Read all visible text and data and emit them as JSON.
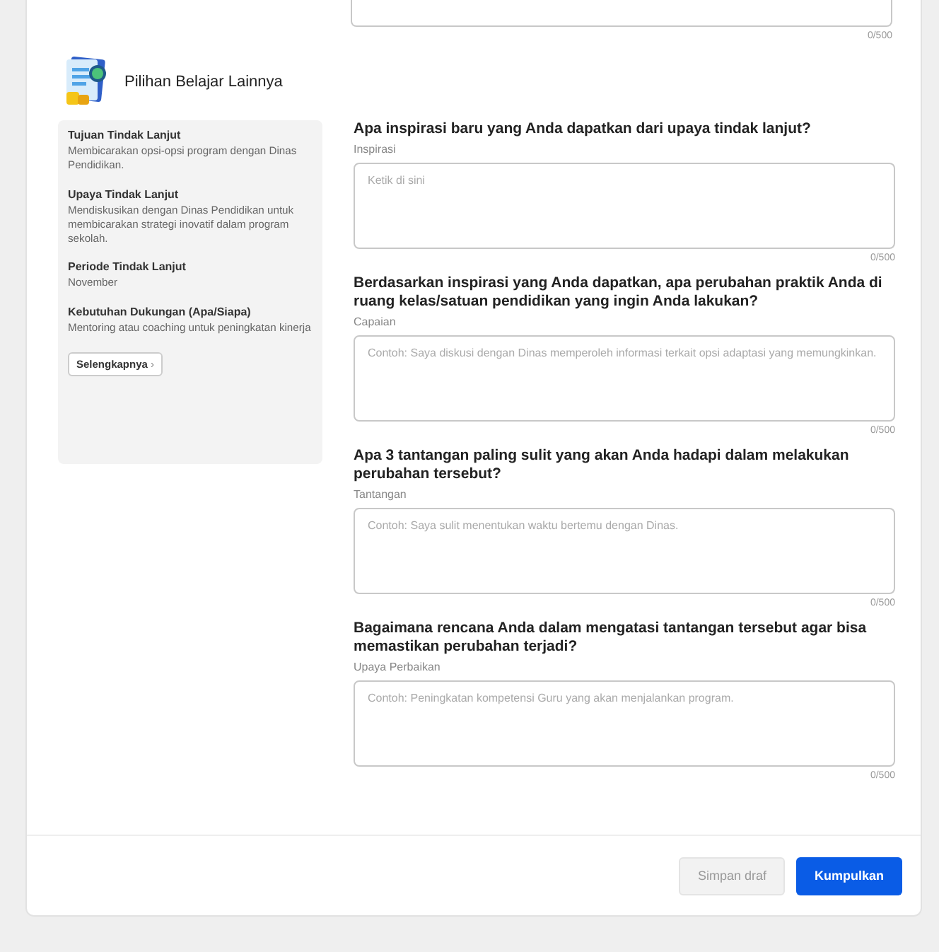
{
  "top_field": {
    "counter": "0/500"
  },
  "section": {
    "title": "Pilihan Belajar Lainnya"
  },
  "sidebar": {
    "items": [
      {
        "label": "Tujuan Tindak Lanjut",
        "value": "Membicarakan opsi-opsi program dengan Dinas Pendidikan."
      },
      {
        "label": "Upaya Tindak Lanjut",
        "value": "Mendiskusikan dengan Dinas Pendidikan untuk membicarakan strategi inovatif dalam program sekolah."
      },
      {
        "label": "Periode Tindak Lanjut",
        "value": "November"
      },
      {
        "label": "Kebutuhan Dukungan (Apa/Siapa)",
        "value": "Mentoring atau coaching untuk peningkatan kinerja"
      }
    ],
    "more_button": {
      "label": "Selengkapnya",
      "icon": "›"
    }
  },
  "questions": [
    {
      "question": "Apa inspirasi baru yang Anda dapatkan dari upaya tindak lanjut?",
      "label": "Inspirasi",
      "placeholder": "Ketik di sini",
      "counter": "0/500"
    },
    {
      "question": "Berdasarkan inspirasi yang Anda dapatkan, apa perubahan praktik Anda di ruang kelas/satuan pendidikan yang ingin Anda lakukan?",
      "label": "Capaian",
      "placeholder": "Contoh: Saya diskusi dengan Dinas memperoleh informasi terkait opsi adaptasi yang memungkinkan.",
      "counter": "0/500"
    },
    {
      "question": "Apa 3 tantangan paling sulit yang akan Anda hadapi dalam melakukan perubahan tersebut?",
      "label": "Tantangan",
      "placeholder": "Contoh: Saya sulit menentukan waktu bertemu dengan Dinas.",
      "counter": "0/500"
    },
    {
      "question": "Bagaimana rencana Anda dalam mengatasi tantangan tersebut agar bisa memastikan perubahan terjadi?",
      "label": "Upaya Perbaikan",
      "placeholder": "Contoh: Peningkatan kompetensi Guru yang akan menjalankan program.",
      "counter": "0/500"
    }
  ],
  "footer": {
    "buttons": [
      {
        "label": "Simpan draf",
        "kind": "secondary",
        "disabled": true
      },
      {
        "label": "Kumpulkan",
        "kind": "primary",
        "disabled": false
      }
    ]
  }
}
